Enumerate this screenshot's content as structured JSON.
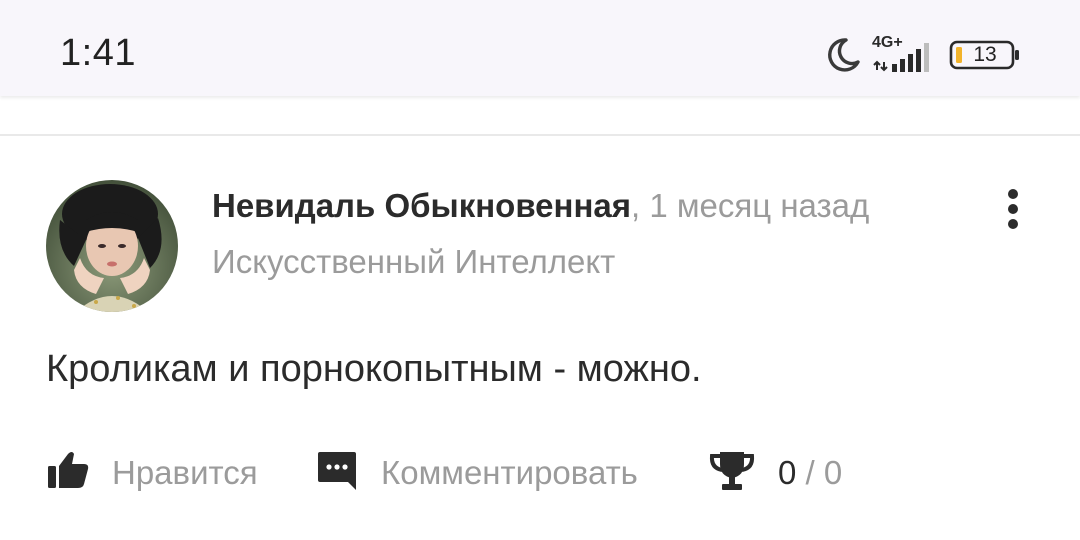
{
  "status_bar": {
    "time": "1:41",
    "network": "4G+",
    "battery": "13",
    "icons": [
      "moon-icon",
      "signal-icon",
      "battery-icon"
    ]
  },
  "comment": {
    "author": "Невидаль Обыкновенная",
    "time_ago": ", 1 месяц назад",
    "category": "Искусственный Интеллект",
    "text": "Кроликам и порнокопытным - можно.",
    "actions": {
      "like_label": "Нравится",
      "comment_label": "Комментировать",
      "award_count": "0",
      "award_separator": " / ",
      "award_total": "0"
    }
  },
  "colors": {
    "text_primary": "#2b2b2b",
    "text_secondary": "#9b9b9b",
    "status_bar_bg": "#f8f6fb",
    "battery_accent": "#f2b32a"
  }
}
